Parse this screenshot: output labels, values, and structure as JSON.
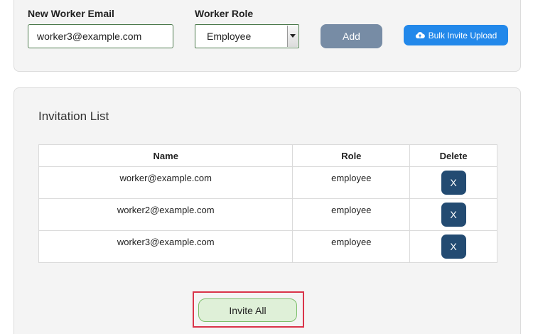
{
  "form": {
    "email_label": "New Worker Email",
    "email_value": "worker3@example.com",
    "role_label": "Worker Role",
    "role_value": "Employee",
    "add_label": "Add",
    "bulk_label": "Bulk Invite Upload",
    "bulk_icon": "cloud-upload-icon"
  },
  "invitations": {
    "title": "Invitation List",
    "columns": [
      "Name",
      "Role",
      "Delete"
    ],
    "rows": [
      {
        "name": "worker@example.com",
        "role": "employee",
        "delete_label": "X"
      },
      {
        "name": "worker2@example.com",
        "role": "employee",
        "delete_label": "X"
      },
      {
        "name": "worker3@example.com",
        "role": "employee",
        "delete_label": "X"
      }
    ],
    "invite_all_label": "Invite All"
  },
  "colors": {
    "add_button": "#778ca5",
    "bulk_button": "#2288ea",
    "delete_button": "#234b72",
    "invite_button_bg": "#dff0d8",
    "invite_button_border": "#7cbf6a",
    "highlight": "#d9344a"
  }
}
